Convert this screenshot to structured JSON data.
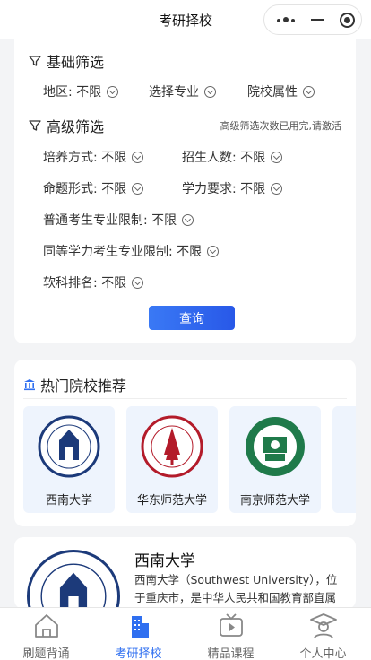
{
  "header": {
    "title": "考研择校"
  },
  "basic_filter": {
    "title": "基础筛选",
    "items": [
      {
        "label": "地区: 不限"
      },
      {
        "label": "选择专业"
      },
      {
        "label": "院校属性"
      }
    ]
  },
  "advanced_filter": {
    "title": "高级筛选",
    "note": "高级筛选次数已用完,请激活",
    "items": [
      {
        "label": "培养方式: 不限"
      },
      {
        "label": "招生人数: 不限"
      },
      {
        "label": "命题形式: 不限"
      },
      {
        "label": "学力要求: 不限"
      },
      {
        "label": "普通考生专业限制: 不限"
      },
      {
        "label": "同等学力考生专业限制: 不限"
      },
      {
        "label": "软科排名: 不限"
      }
    ]
  },
  "query_button": {
    "label": "查询"
  },
  "hot_schools": {
    "title": "热门院校推荐",
    "items": [
      {
        "name": "西南大学"
      },
      {
        "name": "华东师范大学"
      },
      {
        "name": "南京师范大学"
      }
    ]
  },
  "school_detail": {
    "name": "西南大学",
    "description": "西南大学（Southwest University），位于重庆市，是中华人民共和国教育部直属高校，教育部、农业农村部、重庆市共建的"
  },
  "tabbar": {
    "items": [
      {
        "label": "刷题背诵"
      },
      {
        "label": "考研择校"
      },
      {
        "label": "精品课程"
      },
      {
        "label": "个人中心"
      }
    ]
  },
  "colors": {
    "accent": "#2f6ff0",
    "background": "#f3f4f6"
  }
}
